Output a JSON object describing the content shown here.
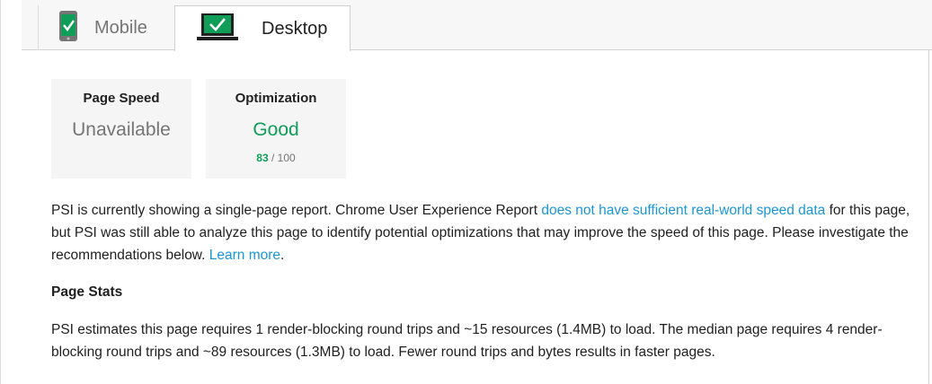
{
  "tabs": [
    {
      "label": "Mobile",
      "icon": "mobile-phone-check-icon",
      "active": false
    },
    {
      "label": "Desktop",
      "icon": "laptop-check-icon",
      "active": true
    }
  ],
  "cards": {
    "page_speed": {
      "title": "Page Speed",
      "value": "Unavailable"
    },
    "optimization": {
      "title": "Optimization",
      "value": "Good",
      "score": "83",
      "score_max": "/ 100"
    }
  },
  "summary": {
    "text1": "PSI is currently showing a single-page report. Chrome User Experience Report ",
    "link1": "does not have sufficient real-world speed data",
    "text2": " for this page, but PSI was still able to analyze this page to identify potential optimizations that may improve the speed of this page. Please investigate the recommendations below. ",
    "link2": "Learn more",
    "text3": "."
  },
  "page_stats": {
    "heading": "Page Stats",
    "text": "PSI estimates this page requires 1 render-blocking round trips and ~15 resources (1.4MB) to load. The median page requires 4 render-blocking round trips and ~89 resources (1.3MB) to load. Fewer round trips and bytes results in faster pages."
  },
  "colors": {
    "good": "#0f9d58",
    "link": "#1a96d4",
    "check_green": "#0f9d58"
  }
}
